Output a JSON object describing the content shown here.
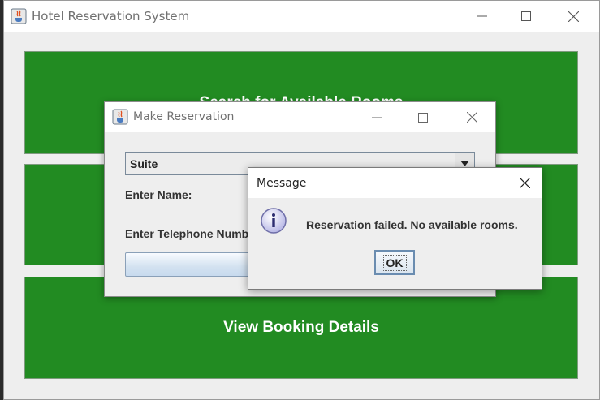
{
  "main_window": {
    "title": "Hotel Reservation System",
    "buttons": {
      "search": "Search for Available Rooms",
      "view": "View Booking Details"
    }
  },
  "reservation_window": {
    "title": "Make Reservation",
    "room_type_selected": "Suite",
    "name_label": "Enter Name:",
    "telephone_label": "Enter Telephone Number:"
  },
  "message_dialog": {
    "title": "Message",
    "icon": "info-icon",
    "message": "Reservation failed. No available rooms.",
    "ok_label": "OK"
  },
  "colors": {
    "action_green": "#228b22",
    "window_bg": "#eeeeee"
  }
}
